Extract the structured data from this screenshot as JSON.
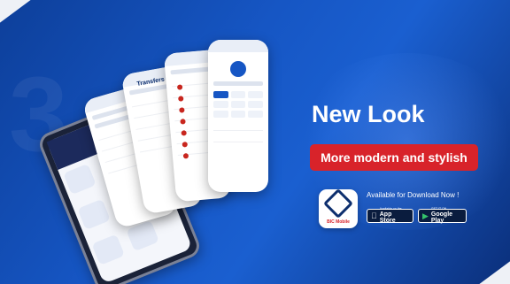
{
  "headline": "New Look",
  "cta": "More modern and stylish",
  "download_text": "Available for Download Now !",
  "app_icon": {
    "name": "BIC Mobile",
    "icon": "bic-logo-icon"
  },
  "app_store": {
    "small": "Available on the",
    "big": "App Store",
    "icon": "apple-icon"
  },
  "google_play": {
    "small": "GET IT ON",
    "big": "Google Play",
    "icon": "play-icon"
  },
  "phones": {
    "transfers_title": "Transfers"
  },
  "colors": {
    "brand_blue": "#1656c4",
    "brand_red": "#d8232a",
    "navy": "#0d2f6e"
  }
}
